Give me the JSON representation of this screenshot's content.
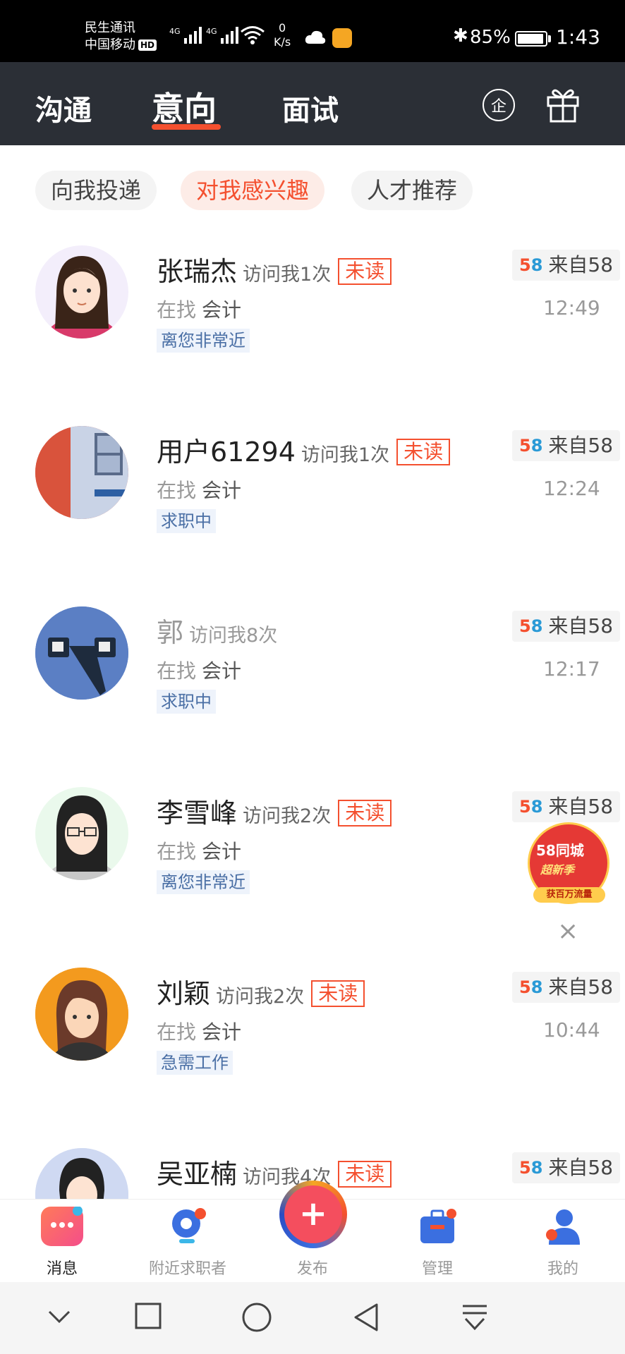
{
  "status_bar": {
    "carrier1": "民生通讯",
    "carrier2": "中国移动",
    "hd": "HD",
    "net1": "4G",
    "net2": "4G",
    "speed_value": "0",
    "speed_unit": "K/s",
    "battery": "85%",
    "time": "1:43"
  },
  "header": {
    "tabs": [
      "沟通",
      "意向",
      "面试"
    ],
    "active_tab": "意向",
    "enterprise_icon": "企"
  },
  "filters": [
    "向我投递",
    "对我感兴趣",
    "人才推荐"
  ],
  "active_filter": "对我感兴趣",
  "candidates": [
    {
      "name": "张瑞杰",
      "visits": "访问我1次",
      "unread": "未读",
      "seeking_label": "在找",
      "job": "会计",
      "tag": "离您非常近",
      "source": "来自58",
      "time": "12:49"
    },
    {
      "name": "用户61294",
      "visits": "访问我1次",
      "unread": "未读",
      "seeking_label": "在找",
      "job": "会计",
      "tag": "求职中",
      "source": "来自58",
      "time": "12:24"
    },
    {
      "name": "郭",
      "visits": "访问我8次",
      "unread": "",
      "seeking_label": "在找",
      "job": "会计",
      "tag": "求职中",
      "source": "来自58",
      "time": "12:17"
    },
    {
      "name": "李雪峰",
      "visits": "访问我2次",
      "unread": "未读",
      "seeking_label": "在找",
      "job": "会计",
      "tag": "离您非常近",
      "source": "来自58",
      "time": ""
    },
    {
      "name": "刘颖",
      "visits": "访问我2次",
      "unread": "未读",
      "seeking_label": "在找",
      "job": "会计",
      "tag": "急需工作",
      "source": "来自58",
      "time": "10:44"
    },
    {
      "name": "吴亚楠",
      "visits": "访问我4次",
      "unread": "未读",
      "seeking_label": "",
      "job": "",
      "tag": "",
      "source": "来自58",
      "time": ""
    }
  ],
  "source_logo": {
    "a": "5",
    "b": "8"
  },
  "ad": {
    "title": "58同城",
    "subtitle": "超新季",
    "ribbon": "获百万流量",
    "close": "×"
  },
  "bottom_nav": [
    {
      "label": "消息",
      "active": true
    },
    {
      "label": "附近求职者",
      "active": false
    },
    {
      "label": "发布",
      "active": false
    },
    {
      "label": "管理",
      "active": false
    },
    {
      "label": "我的",
      "active": false
    }
  ],
  "publish_symbol": "+",
  "colors": {
    "accent": "#f4502f",
    "header_bg": "#2b2f36",
    "tag_blue": "#4a6fa5"
  }
}
